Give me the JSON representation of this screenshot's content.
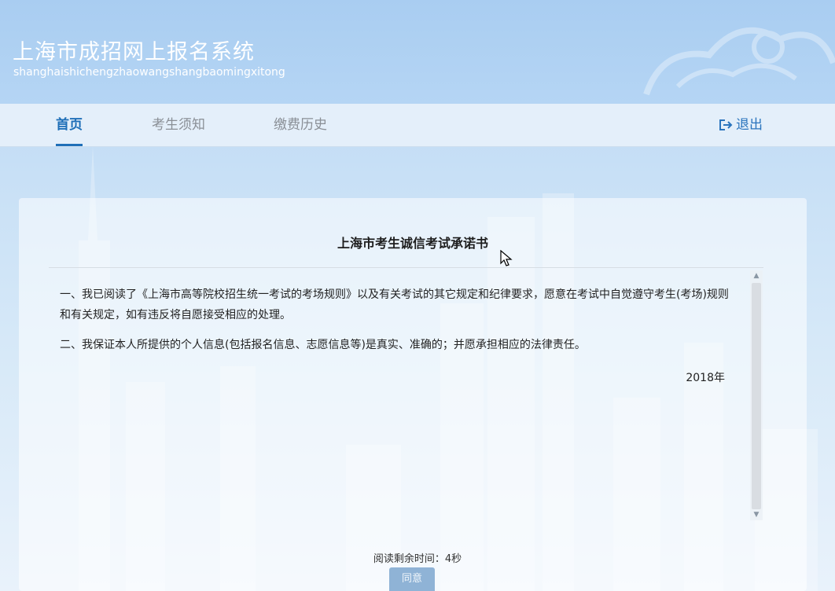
{
  "header": {
    "title": "上海市成招网上报名系统",
    "subtitle": "shanghaishichengzhaowangshangbaomingxitong"
  },
  "nav": {
    "items": [
      {
        "label": "首页",
        "active": true
      },
      {
        "label": "考生须知",
        "active": false
      },
      {
        "label": "缴费历史",
        "active": false
      }
    ],
    "logout_label": "退出",
    "logout_icon": "logout-icon"
  },
  "pledge": {
    "title": "上海市考生诚信考试承诺书",
    "paragraphs": [
      "一、我已阅读了《上海市高等院校招生统一考试的考场规则》以及有关考试的其它规定和纪律要求，愿意在考试中自觉遵守考生(考场)规则和有关规定，如有违反将自愿接受相应的处理。",
      "二、我保证本人所提供的个人信息(包括报名信息、志愿信息等)是真实、准确的；并愿承担相应的法律责任。"
    ],
    "year": "2018年"
  },
  "footer": {
    "timer_text": "阅读剩余时间：4秒",
    "agree_label": "同意"
  },
  "colors": {
    "accent": "#1f6fb8",
    "header_bg": "#b5d5f4",
    "button_disabled": "#8fb3d6"
  }
}
